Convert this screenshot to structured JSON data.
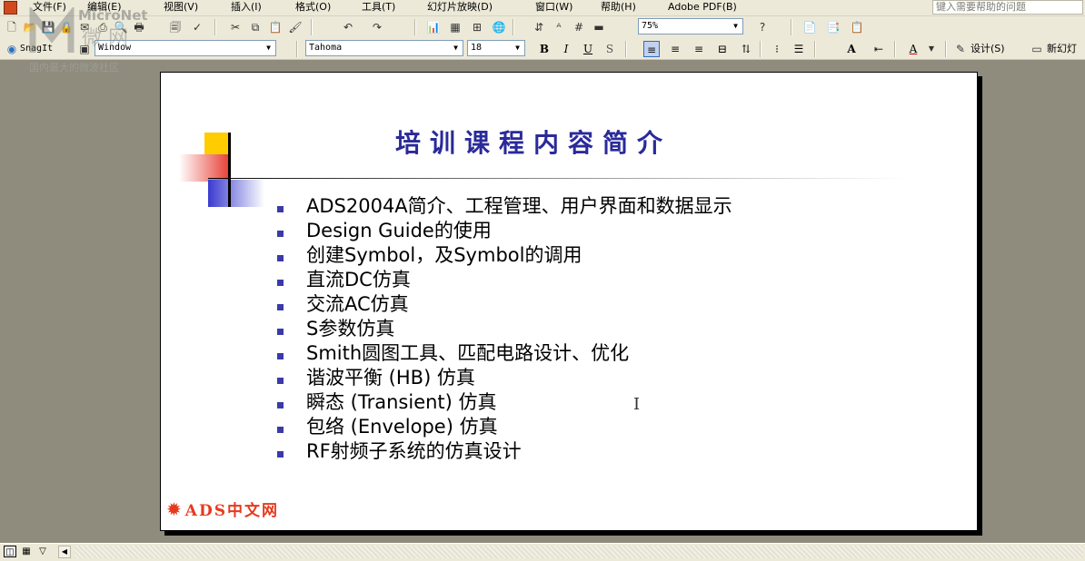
{
  "menubar": {
    "items": [
      "文件(F)",
      "编辑(E)",
      "视图(V)",
      "插入(I)",
      "格式(O)",
      "工具(T)",
      "幻灯片放映(D)",
      "窗口(W)",
      "帮助(H)",
      "Adobe PDF(B)"
    ],
    "help_placeholder": "键入需要帮助的问题"
  },
  "toolbar1": {
    "zoom_value": "75%",
    "icons": [
      "new-icon",
      "open-icon",
      "save-icon",
      "permission-icon",
      "email-icon",
      "print-icon",
      "print-preview-icon",
      "spelling-icon",
      "cut-icon",
      "copy-icon",
      "paste-icon",
      "format-painter-icon",
      "undo-icon",
      "redo-icon",
      "insert-chart-icon",
      "insert-table-icon",
      "tables-borders-icon",
      "hyperlink-icon",
      "expand-all-icon",
      "show-formatting-icon",
      "grid-icon",
      "color-grayscale-icon",
      "help-icon",
      "pdf-icon",
      "pdf-email-icon",
      "pdf-review-icon"
    ]
  },
  "toolbar2": {
    "snagit_label": "SnagIt",
    "window_label": "Window",
    "font_name": "Tahoma",
    "font_size": "18",
    "bold": "B",
    "italic": "I",
    "underline": "U",
    "shadow": "S",
    "design_label": "设计(S)",
    "new_slide_label": "新幻灯"
  },
  "watermark": {
    "name": "MicroNet",
    "cn": "微 网",
    "sub": "国内最大的微波社区"
  },
  "slide": {
    "title": "培训课程内容简介",
    "bullets": [
      "ADS2004A简介、工程管理、用户界面和数据显示",
      "Design Guide的使用",
      "创建Symbol，及Symbol的调用",
      "直流DC仿真",
      "交流AC仿真",
      "S参数仿真",
      "Smith圆图工具、匹配电路设计、优化",
      "谐波平衡 (HB) 仿真",
      "瞬态 (Transient) 仿真",
      "包络 (Envelope) 仿真",
      "RF射频子系统的仿真设计"
    ],
    "footer": "ADS中文网",
    "cursor_glyph": "I"
  },
  "colors": {
    "title": "#2a2a9a",
    "bullet": "#3a3aa8",
    "footer": "#e63a1e",
    "workspace": "#8f8c7e",
    "chrome": "#ece9d8"
  }
}
